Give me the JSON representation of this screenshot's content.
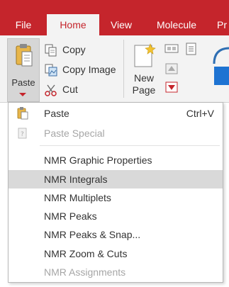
{
  "tabs": {
    "file": "File",
    "home": "Home",
    "view": "View",
    "molecule": "Molecule",
    "more": "Pr"
  },
  "ribbon": {
    "paste_label": "Paste",
    "copy_label": "Copy",
    "copy_image_label": "Copy Image",
    "cut_label": "Cut",
    "new_page_label_line1": "New",
    "new_page_label_line2": "Page"
  },
  "menu": {
    "paste": {
      "label": "Paste",
      "shortcut": "Ctrl+V",
      "icon": "clipboard-icon",
      "enabled": true
    },
    "paste_special": {
      "label": "Paste Special",
      "icon": "paste-special-icon",
      "enabled": false
    },
    "items": [
      {
        "label": "NMR Graphic Properties",
        "enabled": true,
        "highlighted": false
      },
      {
        "label": "NMR Integrals",
        "enabled": true,
        "highlighted": true
      },
      {
        "label": "NMR Multiplets",
        "enabled": true,
        "highlighted": false
      },
      {
        "label": "NMR Peaks",
        "enabled": true,
        "highlighted": false
      },
      {
        "label": "NMR Peaks & Snap...",
        "enabled": true,
        "highlighted": false
      },
      {
        "label": "NMR Zoom & Cuts",
        "enabled": true,
        "highlighted": false
      },
      {
        "label": "NMR Assignments",
        "enabled": false,
        "highlighted": false
      }
    ]
  },
  "colors": {
    "accent_red": "#c5252c",
    "highlight_gray": "#d9d9d9",
    "disabled_text": "#a6a6a6"
  }
}
